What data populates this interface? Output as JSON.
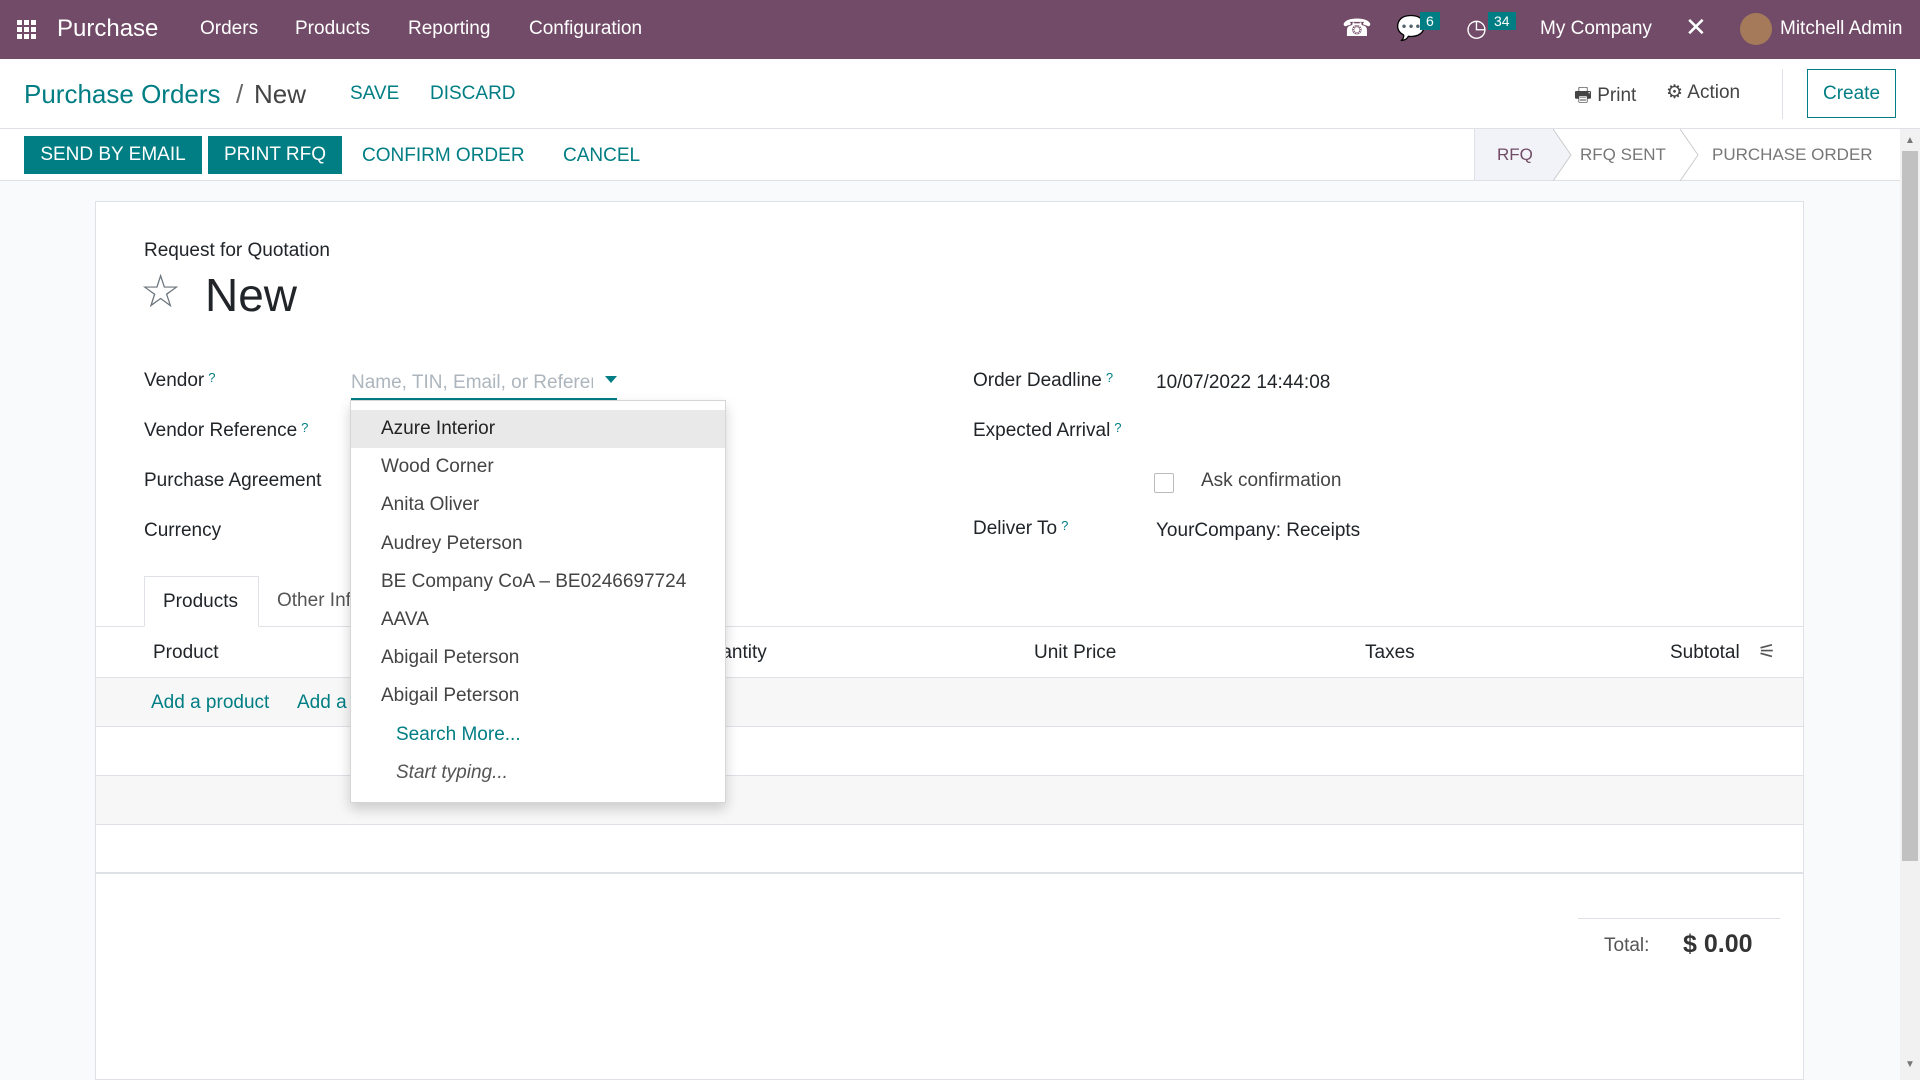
{
  "navbar": {
    "app": "Purchase",
    "menu": [
      "Orders",
      "Products",
      "Reporting",
      "Configuration"
    ],
    "messages_count": "6",
    "activities_count": "34",
    "company": "My Company",
    "user": "Mitchell Admin",
    "brand_color": "#714b67"
  },
  "control_panel": {
    "breadcrumb_parent": "Purchase Orders",
    "breadcrumb_sep": "/",
    "breadcrumb_current": "New",
    "save": "SAVE",
    "discard": "DISCARD",
    "print": "Print",
    "action": "Action",
    "create": "Create"
  },
  "statusbar": {
    "buttons": [
      "SEND BY EMAIL",
      "PRINT RFQ",
      "CONFIRM ORDER",
      "CANCEL"
    ],
    "stages": [
      "RFQ",
      "RFQ SENT",
      "PURCHASE ORDER"
    ],
    "active_stage": "RFQ",
    "accent": "#017e84"
  },
  "form": {
    "subtitle": "Request for Quotation",
    "title": "New",
    "left": {
      "vendor": "Vendor",
      "vendor_placeholder": "Name, TIN, Email, or Reference",
      "vendor_reference": "Vendor Reference",
      "purchase_agreement": "Purchase Agreement",
      "currency": "Currency"
    },
    "right": {
      "order_deadline": "Order Deadline",
      "order_deadline_value": "10/07/2022 14:44:08",
      "expected_arrival": "Expected Arrival",
      "ask_confirmation": "Ask confirmation",
      "deliver_to": "Deliver To",
      "deliver_to_value": "YourCompany: Receipts"
    },
    "tabs": [
      "Products",
      "Other Info"
    ],
    "table": {
      "columns": [
        "Product",
        "Quantity",
        "Unit Price",
        "Taxes",
        "Subtotal"
      ],
      "add_product": "Add a product",
      "add_section": "Add a section"
    },
    "total_label": "Total:",
    "total_value": "$ 0.00"
  },
  "dropdown": {
    "items": [
      "Azure Interior",
      "Wood Corner",
      "Anita Oliver",
      "Audrey Peterson",
      "BE Company CoA – BE0246697724",
      "AAVA",
      "Abigail Peterson",
      "Abigail Peterson"
    ],
    "search_more": "Search More...",
    "start_typing": "Start typing..."
  }
}
